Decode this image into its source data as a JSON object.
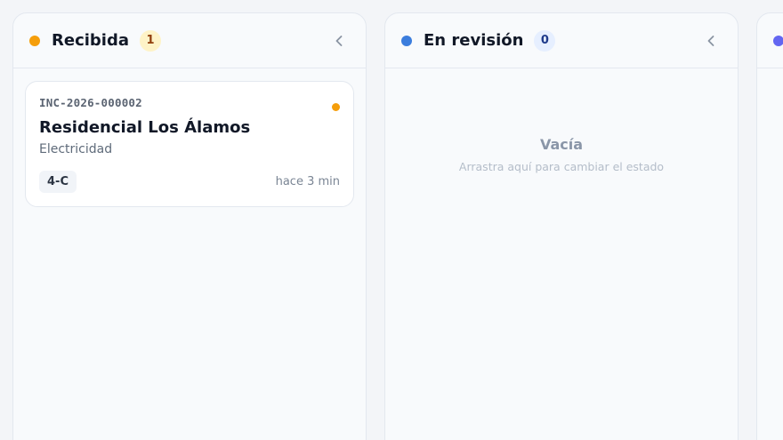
{
  "colors": {
    "received": "#f59e0b",
    "received_badge_bg": "#fef3c7",
    "received_badge_text": "#92400e",
    "review": "#3b7ddd",
    "review_badge_bg": "#e6efff",
    "review_badge_text": "#1e3a8a",
    "third": "#6366f1"
  },
  "columns": [
    {
      "title": "Recibida",
      "count": "1",
      "cards": [
        {
          "id": "INC-2026-000002",
          "title": "Residencial Los Álamos",
          "category": "Electricidad",
          "unit": "4-C",
          "time": "hace 3 min"
        }
      ]
    },
    {
      "title": "En revisión",
      "count": "0",
      "empty_title": "Vacía",
      "empty_subtitle": "Arrastra aquí para cambiar el estado"
    }
  ],
  "icons": {
    "collapse": "chevron-left-icon",
    "status": "status-dot-icon"
  }
}
